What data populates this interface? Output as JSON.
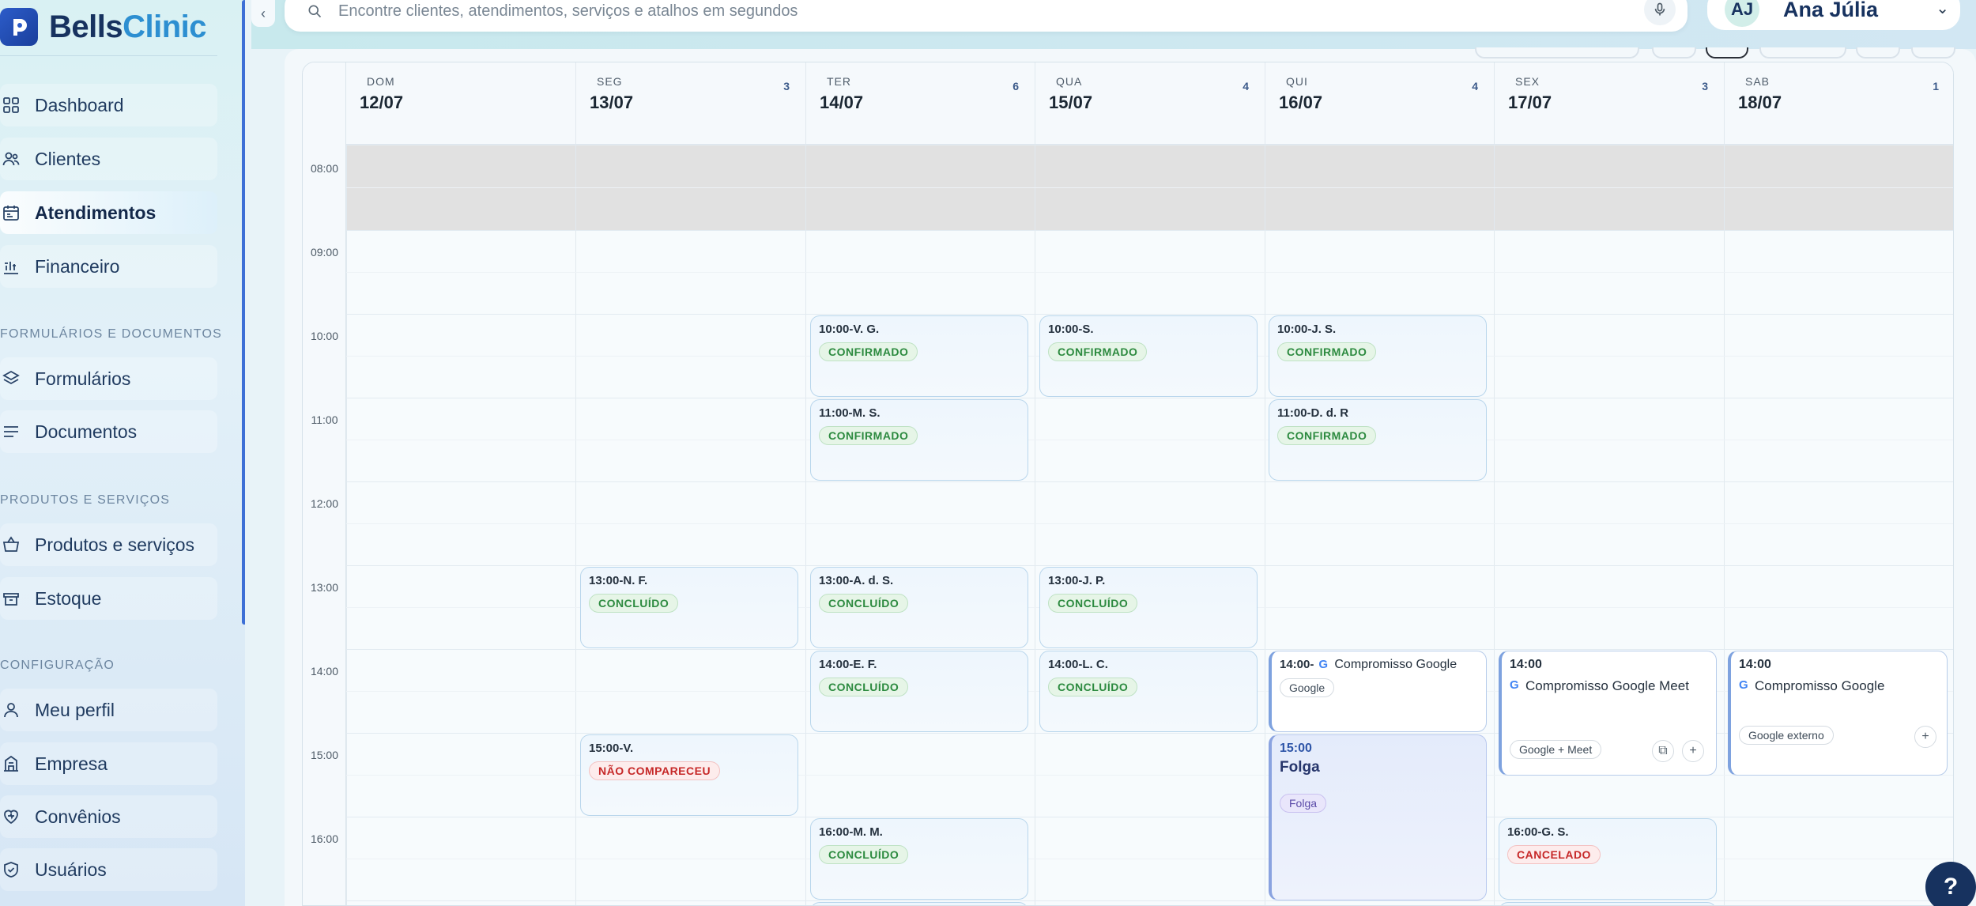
{
  "brand": {
    "name_part1": "Bells",
    "name_part2": "Clinic"
  },
  "sidebar": {
    "items": [
      {
        "label": "Dashboard",
        "icon": "dashboard-icon"
      },
      {
        "label": "Clientes",
        "icon": "users-icon"
      },
      {
        "label": "Atendimentos",
        "icon": "calendar-icon",
        "active": true
      },
      {
        "label": "Financeiro",
        "icon": "chart-icon"
      }
    ],
    "section_forms": "FORMULÁRIOS E DOCUMENTOS",
    "forms_items": [
      {
        "label": "Formulários",
        "icon": "layers-icon"
      },
      {
        "label": "Documentos",
        "icon": "lines-icon"
      }
    ],
    "section_products": "PRODUTOS E SERVIÇOS",
    "product_items": [
      {
        "label": "Produtos e serviços",
        "icon": "basket-icon"
      },
      {
        "label": "Estoque",
        "icon": "box-icon"
      }
    ],
    "section_config": "CONFIGURAÇÃO",
    "config_items": [
      {
        "label": "Meu perfil",
        "icon": "user-icon"
      },
      {
        "label": "Empresa",
        "icon": "building-icon"
      },
      {
        "label": "Convênios",
        "icon": "heart-icon"
      },
      {
        "label": "Usuários",
        "icon": "shield-icon"
      }
    ]
  },
  "topbar": {
    "collapse_glyph": "‹",
    "search_placeholder": "Encontre clientes, atendimentos, serviços e atalhos em segundos",
    "user_initials": "AJ",
    "user_name": "Ana Júlia",
    "caret": "⌄"
  },
  "calendar": {
    "days": [
      {
        "abbr": "DOM",
        "date": "12/07",
        "count": ""
      },
      {
        "abbr": "SEG",
        "date": "13/07",
        "count": "3"
      },
      {
        "abbr": "TER",
        "date": "14/07",
        "count": "6"
      },
      {
        "abbr": "QUA",
        "date": "15/07",
        "count": "4"
      },
      {
        "abbr": "QUI",
        "date": "16/07",
        "count": "4"
      },
      {
        "abbr": "SEX",
        "date": "17/07",
        "count": "3"
      },
      {
        "abbr": "SAB",
        "date": "18/07",
        "count": "1"
      }
    ],
    "hours": [
      "08:00",
      "09:00",
      "10:00",
      "11:00",
      "12:00",
      "13:00",
      "14:00",
      "15:00",
      "16:00"
    ],
    "events": [
      {
        "title": "10:00-V. G.",
        "status": "CONFIRMADO",
        "color": "green"
      },
      {
        "title": "10:00-S.",
        "status": "CONFIRMADO",
        "color": "green"
      },
      {
        "title": "10:00-J. S.",
        "status": "CONFIRMADO",
        "color": "green"
      },
      {
        "title": "11:00-M. S.",
        "status": "CONFIRMADO",
        "color": "green"
      },
      {
        "title": "11:00-D. d. R",
        "status": "CONFIRMADO",
        "color": "green"
      },
      {
        "title": "13:00-N. F.",
        "status": "CONCLUÍDO",
        "color": "green"
      },
      {
        "title": "13:00-A. d. S.",
        "status": "CONCLUÍDO",
        "color": "green"
      },
      {
        "title": "13:00-J. P.",
        "status": "CONCLUÍDO",
        "color": "green"
      },
      {
        "title": "14:00-E. F.",
        "status": "CONCLUÍDO",
        "color": "green"
      },
      {
        "title": "14:00-L. C.",
        "status": "CONCLUÍDO",
        "color": "green"
      },
      {
        "title": "15:00-V.",
        "status": "NÃO COMPARECEU",
        "color": "red"
      },
      {
        "title": "16:00-M. M.",
        "status": "CONCLUÍDO",
        "color": "green"
      },
      {
        "title": "16:00-G. S.",
        "status": "CANCELADO",
        "color": "red"
      }
    ],
    "google_events": {
      "qui": {
        "time": "14:00-",
        "title": "Compromisso Google",
        "tag": "Google"
      },
      "sex": {
        "time": "14:00",
        "title": "Compromisso Google Meet",
        "tag": "Google + Meet"
      },
      "sab": {
        "time": "14:00",
        "title": "Compromisso Google",
        "tag": "Google externo"
      }
    },
    "folga": {
      "time": "15:00",
      "title": "Folga",
      "tag": "Folga"
    },
    "google_glyph": "G",
    "plus_glyph": "+",
    "external_glyph": "⧉"
  },
  "help": {
    "label": "?"
  }
}
